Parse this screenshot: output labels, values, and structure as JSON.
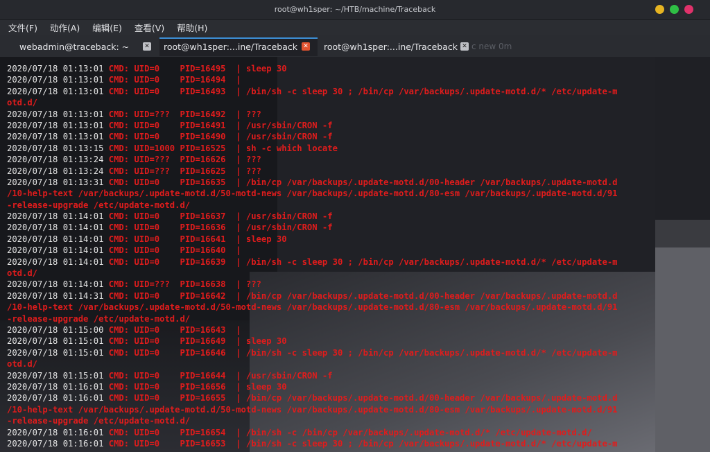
{
  "window": {
    "title": "root@wh1sper: ~/HTB/machine/Traceback",
    "controls": [
      {
        "name": "minimize",
        "color": "#e6b422"
      },
      {
        "name": "maximize",
        "color": "#2fbf45"
      },
      {
        "name": "close",
        "color": "#e0326b"
      }
    ]
  },
  "menu": [
    {
      "label": "文件(F)"
    },
    {
      "label": "动作(A)"
    },
    {
      "label": "编辑(E)"
    },
    {
      "label": "查看(V)"
    },
    {
      "label": "帮助(H)"
    }
  ],
  "tabs": [
    {
      "label": "webadmin@traceback: ~",
      "active": false
    },
    {
      "label": "root@wh1sper:...ine/Traceback",
      "active": true
    },
    {
      "label": "root@wh1sper:...ine/Traceback",
      "active": false
    }
  ],
  "tab_ghost_text": "c new  0m",
  "colors": {
    "timestamp": "#e6e6e6",
    "log_text": "#e01c1c",
    "active_tab_close": "#e3532f",
    "inactive_tab_close": "#bfc1c6"
  },
  "terminal_lines": [
    {
      "ts": "2020/07/18 01:13:01",
      "text": " CMD: UID=0    PID=16495  | sleep 30"
    },
    {
      "ts": "2020/07/18 01:13:01",
      "text": " CMD: UID=0    PID=16494  | "
    },
    {
      "ts": "2020/07/18 01:13:01",
      "text": " CMD: UID=0    PID=16493  | /bin/sh -c sleep 30 ; /bin/cp /var/backups/.update-motd.d/* /etc/update-m"
    },
    {
      "ts": "",
      "text": "otd.d/"
    },
    {
      "ts": "2020/07/18 01:13:01",
      "text": " CMD: UID=???  PID=16492  | ???"
    },
    {
      "ts": "2020/07/18 01:13:01",
      "text": " CMD: UID=0    PID=16491  | /usr/sbin/CRON -f"
    },
    {
      "ts": "2020/07/18 01:13:01",
      "text": " CMD: UID=0    PID=16490  | /usr/sbin/CRON -f"
    },
    {
      "ts": "2020/07/18 01:13:15",
      "text": " CMD: UID=1000 PID=16525  | sh -c which locate"
    },
    {
      "ts": "2020/07/18 01:13:24",
      "text": " CMD: UID=???  PID=16626  | ???"
    },
    {
      "ts": "2020/07/18 01:13:24",
      "text": " CMD: UID=???  PID=16625  | ???"
    },
    {
      "ts": "2020/07/18 01:13:31",
      "text": " CMD: UID=0    PID=16635  | /bin/cp /var/backups/.update-motd.d/00-header /var/backups/.update-motd.d"
    },
    {
      "ts": "",
      "text": "/10-help-text /var/backups/.update-motd.d/50-motd-news /var/backups/.update-motd.d/80-esm /var/backups/.update-motd.d/91"
    },
    {
      "ts": "",
      "text": "-release-upgrade /etc/update-motd.d/"
    },
    {
      "ts": "2020/07/18 01:14:01",
      "text": " CMD: UID=0    PID=16637  | /usr/sbin/CRON -f"
    },
    {
      "ts": "2020/07/18 01:14:01",
      "text": " CMD: UID=0    PID=16636  | /usr/sbin/CRON -f"
    },
    {
      "ts": "2020/07/18 01:14:01",
      "text": " CMD: UID=0    PID=16641  | sleep 30"
    },
    {
      "ts": "2020/07/18 01:14:01",
      "text": " CMD: UID=0    PID=16640  | "
    },
    {
      "ts": "2020/07/18 01:14:01",
      "text": " CMD: UID=0    PID=16639  | /bin/sh -c sleep 30 ; /bin/cp /var/backups/.update-motd.d/* /etc/update-m"
    },
    {
      "ts": "",
      "text": "otd.d/"
    },
    {
      "ts": "2020/07/18 01:14:01",
      "text": " CMD: UID=???  PID=16638  | ???"
    },
    {
      "ts": "2020/07/18 01:14:31",
      "text": " CMD: UID=0    PID=16642  | /bin/cp /var/backups/.update-motd.d/00-header /var/backups/.update-motd.d"
    },
    {
      "ts": "",
      "text": "/10-help-text /var/backups/.update-motd.d/50-motd-news /var/backups/.update-motd.d/80-esm /var/backups/.update-motd.d/91"
    },
    {
      "ts": "",
      "text": "-release-upgrade /etc/update-motd.d/"
    },
    {
      "ts": "2020/07/18 01:15:00",
      "text": " CMD: UID=0    PID=16643  | "
    },
    {
      "ts": "2020/07/18 01:15:01",
      "text": " CMD: UID=0    PID=16649  | sleep 30"
    },
    {
      "ts": "2020/07/18 01:15:01",
      "text": " CMD: UID=0    PID=16646  | /bin/sh -c sleep 30 ; /bin/cp /var/backups/.update-motd.d/* /etc/update-m"
    },
    {
      "ts": "",
      "text": "otd.d/"
    },
    {
      "ts": "2020/07/18 01:15:01",
      "text": " CMD: UID=0    PID=16644  | /usr/sbin/CRON -f"
    },
    {
      "ts": "2020/07/18 01:16:01",
      "text": " CMD: UID=0    PID=16656  | sleep 30"
    },
    {
      "ts": "2020/07/18 01:16:01",
      "text": " CMD: UID=0    PID=16655  | /bin/cp /var/backups/.update-motd.d/00-header /var/backups/.update-motd.d"
    },
    {
      "ts": "",
      "text": "/10-help-text /var/backups/.update-motd.d/50-motd-news /var/backups/.update-motd.d/80-esm /var/backups/.update-motd.d/91"
    },
    {
      "ts": "",
      "text": "-release-upgrade /etc/update-motd.d/"
    },
    {
      "ts": "2020/07/18 01:16:01",
      "text": " CMD: UID=0    PID=16654  | /bin/sh -c /bin/cp /var/backups/.update-motd.d/* /etc/update-motd.d/"
    },
    {
      "ts": "2020/07/18 01:16:01",
      "text": " CMD: UID=0    PID=16653  | /bin/sh -c sleep 30 ; /bin/cp /var/backups/.update-motd.d/* /etc/update-m"
    }
  ]
}
